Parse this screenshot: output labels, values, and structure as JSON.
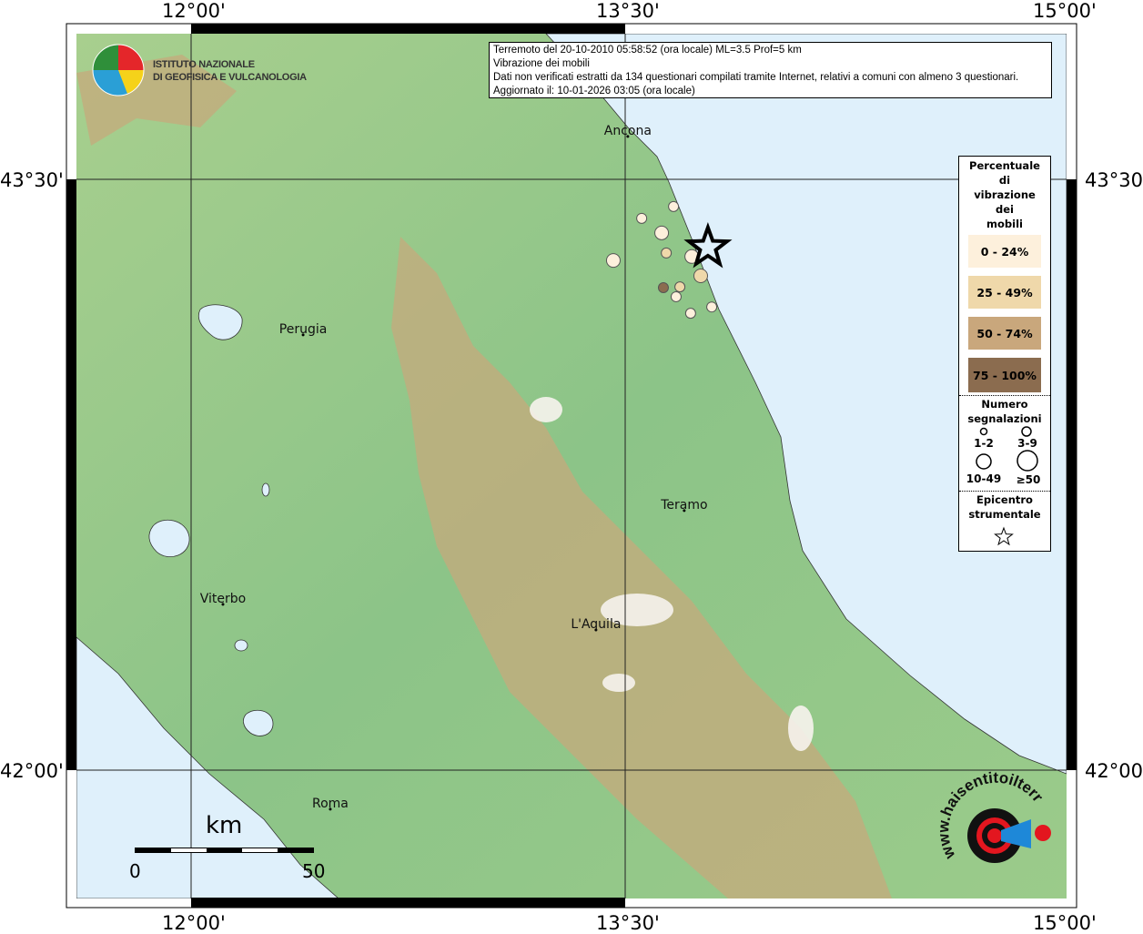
{
  "map_extent": {
    "lon_min": 11.604,
    "lon_max": 15.025,
    "lat_min": 41.674,
    "lat_max": 43.87
  },
  "axes": {
    "lon_ticks": [
      {
        "value": 12.0,
        "label": "12°00'"
      },
      {
        "value": 13.5,
        "label": "13°30'"
      },
      {
        "value": 15.0,
        "label": "15°00'"
      }
    ],
    "lat_ticks": [
      {
        "value": 43.5,
        "label": "43°30'"
      },
      {
        "value": 42.0,
        "label": "42°00'"
      }
    ]
  },
  "info": {
    "line1": "Terremoto del 20-10-2010 05:58:52 (ora locale) ML=3.5 Prof=5 km",
    "line2": "Vibrazione dei mobili",
    "line3": "Dati non verificati estratti da 134 questionari compilati tramite Internet, relativi a comuni con almeno 3 questionari.",
    "line4": "Aggiornato il: 10-01-2026 03:05 (ora locale)"
  },
  "logo": {
    "name": "ISTITUTO NAZIONALE DI GEOFISICA E VULCANOLOGIA",
    "line1": "ISTITUTO NAZIONALE",
    "line2": "DI GEOFISICA E VULCANOLOGIA"
  },
  "logo2": {
    "text": "www.haisentitoilterremoto.it"
  },
  "legend": {
    "title": "Percentuale di vibrazione dei mobili",
    "title_lines": [
      "Percentuale",
      "di",
      "vibrazione",
      "dei",
      "mobili"
    ],
    "classes": [
      {
        "label": "0 - 24%",
        "color": "#fdf0dc"
      },
      {
        "label": "25 - 49%",
        "color": "#efd8aa"
      },
      {
        "label": "50 - 74%",
        "color": "#c9a77c"
      },
      {
        "label": "75 - 100%",
        "color": "#8b6c4f"
      }
    ],
    "size_title_lines": [
      "Numero",
      "segnalazioni"
    ],
    "sizes": [
      {
        "label": "1-2"
      },
      {
        "label": "3-9"
      },
      {
        "label": "10-49"
      },
      {
        "label": "≥50"
      }
    ],
    "epicenter_lines": [
      "Epicentro",
      "strumentale"
    ]
  },
  "epicenter": {
    "lon": 13.786,
    "lat": 43.327
  },
  "points": [
    {
      "lon": 13.667,
      "lat": 43.431,
      "class": 0,
      "size": 1
    },
    {
      "lon": 13.557,
      "lat": 43.401,
      "class": 0,
      "size": 1
    },
    {
      "lon": 13.626,
      "lat": 43.364,
      "class": 0,
      "size": 2
    },
    {
      "lon": 13.642,
      "lat": 43.313,
      "class": 1,
      "size": 1
    },
    {
      "lon": 13.459,
      "lat": 43.294,
      "class": 0,
      "size": 2
    },
    {
      "lon": 13.73,
      "lat": 43.304,
      "class": 0,
      "size": 2
    },
    {
      "lon": 13.761,
      "lat": 43.255,
      "class": 1,
      "size": 2
    },
    {
      "lon": 13.632,
      "lat": 43.225,
      "class": 3,
      "size": 1
    },
    {
      "lon": 13.689,
      "lat": 43.227,
      "class": 1,
      "size": 1
    },
    {
      "lon": 13.676,
      "lat": 43.202,
      "class": 0,
      "size": 1
    },
    {
      "lon": 13.799,
      "lat": 43.176,
      "class": 0,
      "size": 1
    },
    {
      "lon": 13.726,
      "lat": 43.16,
      "class": 0,
      "size": 1
    }
  ],
  "cities": [
    {
      "name": "Ancona",
      "lon": 13.509,
      "lat": 43.609
    },
    {
      "name": "Perugia",
      "lon": 12.387,
      "lat": 43.105
    },
    {
      "name": "Teramo",
      "lon": 13.704,
      "lat": 42.659
    },
    {
      "name": "Viterbo",
      "lon": 12.11,
      "lat": 42.421
    },
    {
      "name": "L'Aquila",
      "lon": 13.399,
      "lat": 42.356
    },
    {
      "name": "Roma",
      "lon": 12.481,
      "lat": 41.901
    }
  ],
  "scalebar": {
    "unit": "km",
    "start": "0",
    "end": "50"
  },
  "colors": {
    "sea": "#dff0fb",
    "land": "#8fc58a",
    "mountain": "#c6a97c"
  }
}
